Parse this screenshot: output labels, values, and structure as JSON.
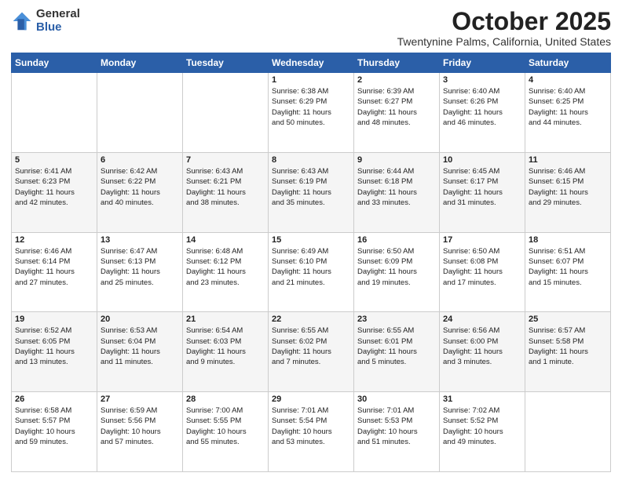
{
  "logo": {
    "general": "General",
    "blue": "Blue"
  },
  "header": {
    "month": "October 2025",
    "location": "Twentynine Palms, California, United States"
  },
  "weekdays": [
    "Sunday",
    "Monday",
    "Tuesday",
    "Wednesday",
    "Thursday",
    "Friday",
    "Saturday"
  ],
  "weeks": [
    [
      {
        "day": "",
        "info": ""
      },
      {
        "day": "",
        "info": ""
      },
      {
        "day": "",
        "info": ""
      },
      {
        "day": "1",
        "info": "Sunrise: 6:38 AM\nSunset: 6:29 PM\nDaylight: 11 hours\nand 50 minutes."
      },
      {
        "day": "2",
        "info": "Sunrise: 6:39 AM\nSunset: 6:27 PM\nDaylight: 11 hours\nand 48 minutes."
      },
      {
        "day": "3",
        "info": "Sunrise: 6:40 AM\nSunset: 6:26 PM\nDaylight: 11 hours\nand 46 minutes."
      },
      {
        "day": "4",
        "info": "Sunrise: 6:40 AM\nSunset: 6:25 PM\nDaylight: 11 hours\nand 44 minutes."
      }
    ],
    [
      {
        "day": "5",
        "info": "Sunrise: 6:41 AM\nSunset: 6:23 PM\nDaylight: 11 hours\nand 42 minutes."
      },
      {
        "day": "6",
        "info": "Sunrise: 6:42 AM\nSunset: 6:22 PM\nDaylight: 11 hours\nand 40 minutes."
      },
      {
        "day": "7",
        "info": "Sunrise: 6:43 AM\nSunset: 6:21 PM\nDaylight: 11 hours\nand 38 minutes."
      },
      {
        "day": "8",
        "info": "Sunrise: 6:43 AM\nSunset: 6:19 PM\nDaylight: 11 hours\nand 35 minutes."
      },
      {
        "day": "9",
        "info": "Sunrise: 6:44 AM\nSunset: 6:18 PM\nDaylight: 11 hours\nand 33 minutes."
      },
      {
        "day": "10",
        "info": "Sunrise: 6:45 AM\nSunset: 6:17 PM\nDaylight: 11 hours\nand 31 minutes."
      },
      {
        "day": "11",
        "info": "Sunrise: 6:46 AM\nSunset: 6:15 PM\nDaylight: 11 hours\nand 29 minutes."
      }
    ],
    [
      {
        "day": "12",
        "info": "Sunrise: 6:46 AM\nSunset: 6:14 PM\nDaylight: 11 hours\nand 27 minutes."
      },
      {
        "day": "13",
        "info": "Sunrise: 6:47 AM\nSunset: 6:13 PM\nDaylight: 11 hours\nand 25 minutes."
      },
      {
        "day": "14",
        "info": "Sunrise: 6:48 AM\nSunset: 6:12 PM\nDaylight: 11 hours\nand 23 minutes."
      },
      {
        "day": "15",
        "info": "Sunrise: 6:49 AM\nSunset: 6:10 PM\nDaylight: 11 hours\nand 21 minutes."
      },
      {
        "day": "16",
        "info": "Sunrise: 6:50 AM\nSunset: 6:09 PM\nDaylight: 11 hours\nand 19 minutes."
      },
      {
        "day": "17",
        "info": "Sunrise: 6:50 AM\nSunset: 6:08 PM\nDaylight: 11 hours\nand 17 minutes."
      },
      {
        "day": "18",
        "info": "Sunrise: 6:51 AM\nSunset: 6:07 PM\nDaylight: 11 hours\nand 15 minutes."
      }
    ],
    [
      {
        "day": "19",
        "info": "Sunrise: 6:52 AM\nSunset: 6:05 PM\nDaylight: 11 hours\nand 13 minutes."
      },
      {
        "day": "20",
        "info": "Sunrise: 6:53 AM\nSunset: 6:04 PM\nDaylight: 11 hours\nand 11 minutes."
      },
      {
        "day": "21",
        "info": "Sunrise: 6:54 AM\nSunset: 6:03 PM\nDaylight: 11 hours\nand 9 minutes."
      },
      {
        "day": "22",
        "info": "Sunrise: 6:55 AM\nSunset: 6:02 PM\nDaylight: 11 hours\nand 7 minutes."
      },
      {
        "day": "23",
        "info": "Sunrise: 6:55 AM\nSunset: 6:01 PM\nDaylight: 11 hours\nand 5 minutes."
      },
      {
        "day": "24",
        "info": "Sunrise: 6:56 AM\nSunset: 6:00 PM\nDaylight: 11 hours\nand 3 minutes."
      },
      {
        "day": "25",
        "info": "Sunrise: 6:57 AM\nSunset: 5:58 PM\nDaylight: 11 hours\nand 1 minute."
      }
    ],
    [
      {
        "day": "26",
        "info": "Sunrise: 6:58 AM\nSunset: 5:57 PM\nDaylight: 10 hours\nand 59 minutes."
      },
      {
        "day": "27",
        "info": "Sunrise: 6:59 AM\nSunset: 5:56 PM\nDaylight: 10 hours\nand 57 minutes."
      },
      {
        "day": "28",
        "info": "Sunrise: 7:00 AM\nSunset: 5:55 PM\nDaylight: 10 hours\nand 55 minutes."
      },
      {
        "day": "29",
        "info": "Sunrise: 7:01 AM\nSunset: 5:54 PM\nDaylight: 10 hours\nand 53 minutes."
      },
      {
        "day": "30",
        "info": "Sunrise: 7:01 AM\nSunset: 5:53 PM\nDaylight: 10 hours\nand 51 minutes."
      },
      {
        "day": "31",
        "info": "Sunrise: 7:02 AM\nSunset: 5:52 PM\nDaylight: 10 hours\nand 49 minutes."
      },
      {
        "day": "",
        "info": ""
      }
    ]
  ]
}
